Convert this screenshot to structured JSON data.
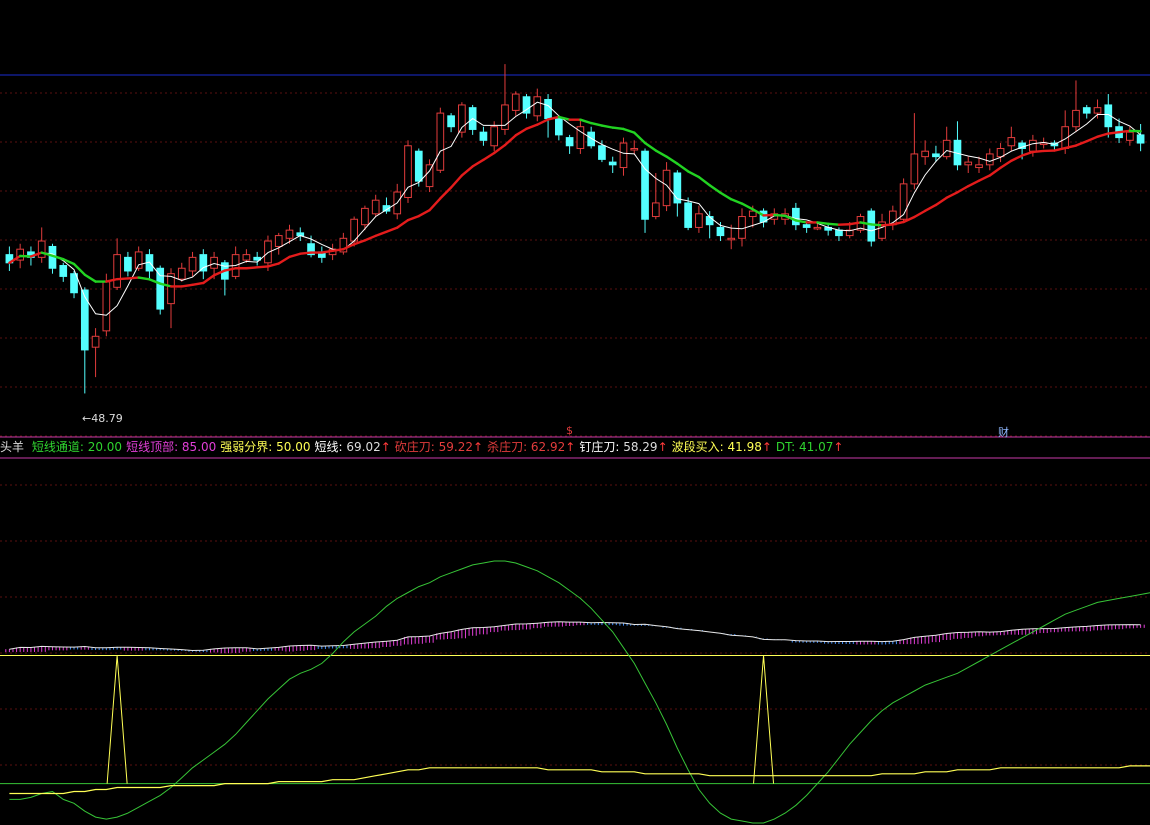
{
  "colors": {
    "background": "#000000",
    "up": "#e23c3c",
    "down": "#54ffff",
    "ma_short": "#ffffff",
    "ma_long_up": "#e41c1c",
    "ma_long_down": "#22d322",
    "grid": "#5a1010",
    "top_rule": "#1a2bd0",
    "separator": "#c83aa8",
    "lower_green": "#37c437",
    "lower_yellow": "#ffff55",
    "hist_up": "#e23fd8",
    "hist_down": "#3f8fff"
  },
  "legend": {
    "name": "头羊",
    "items": [
      {
        "label": "短线通道:",
        "value": "20.00",
        "color": "#2fd32f",
        "arrow": ""
      },
      {
        "label": "短线顶部:",
        "value": "85.00",
        "color": "#e23fd8",
        "arrow": ""
      },
      {
        "label": "强弱分界:",
        "value": "50.00",
        "color": "#ffff55",
        "arrow": ""
      },
      {
        "label": "短线:",
        "value": "69.02",
        "color": "#ffffff",
        "arrow": "↑"
      },
      {
        "label": "砍庄刀:",
        "value": "59.22",
        "color": "#e23c3c",
        "arrow": "↑"
      },
      {
        "label": "杀庄刀:",
        "value": "62.92",
        "color": "#e23c3c",
        "arrow": "↑"
      },
      {
        "label": "钉庄刀:",
        "value": "58.29",
        "color": "#ffffff",
        "arrow": "↑"
      },
      {
        "label": "波段买入:",
        "value": "41.98",
        "color": "#ffff55",
        "arrow": "↑"
      },
      {
        "label": "DT:",
        "value": "41.07",
        "color": "#2fd32f",
        "arrow": "↑"
      }
    ]
  },
  "low_label": "←48.79",
  "markers": {
    "center": "$",
    "right": "财"
  },
  "chart_data": [
    {
      "type": "candlestick",
      "price_range": [
        47.5,
        60.8
      ],
      "candles": [
        [
          54.2,
          53.9,
          54.5,
          53.6
        ],
        [
          54.0,
          54.4,
          54.6,
          53.7
        ],
        [
          54.3,
          54.1,
          54.5,
          53.8
        ],
        [
          54.1,
          54.7,
          55.2,
          53.9
        ],
        [
          54.5,
          53.7,
          54.6,
          53.5
        ],
        [
          53.8,
          53.4,
          53.9,
          53.2
        ],
        [
          53.5,
          52.8,
          53.6,
          52.6
        ],
        [
          52.9,
          50.7,
          53.0,
          49.1
        ],
        [
          50.8,
          51.2,
          51.5,
          49.7
        ],
        [
          51.4,
          53.2,
          53.5,
          51.2
        ],
        [
          53.0,
          54.2,
          54.8,
          52.9
        ],
        [
          54.1,
          53.6,
          54.3,
          53.4
        ],
        [
          53.7,
          54.3,
          54.5,
          53.6
        ],
        [
          54.2,
          53.6,
          54.4,
          53.3
        ],
        [
          53.7,
          52.2,
          53.8,
          52.0
        ],
        [
          52.4,
          53.5,
          53.7,
          51.5
        ],
        [
          53.3,
          53.7,
          53.9,
          53.2
        ],
        [
          53.6,
          54.1,
          54.3,
          53.4
        ],
        [
          54.2,
          53.6,
          54.4,
          53.3
        ],
        [
          53.7,
          54.1,
          54.3,
          53.3
        ],
        [
          53.9,
          53.3,
          54.0,
          52.7
        ],
        [
          53.4,
          54.2,
          54.5,
          53.3
        ],
        [
          54.0,
          54.2,
          54.4,
          53.9
        ],
        [
          54.1,
          54.0,
          54.3,
          53.8
        ],
        [
          53.9,
          54.7,
          54.9,
          53.6
        ],
        [
          54.5,
          54.9,
          55.0,
          54.2
        ],
        [
          54.8,
          55.1,
          55.3,
          54.6
        ],
        [
          55.0,
          54.9,
          55.2,
          54.7
        ],
        [
          54.6,
          54.2,
          54.9,
          54.1
        ],
        [
          54.3,
          54.1,
          54.5,
          53.9
        ],
        [
          54.2,
          54.4,
          54.6,
          54.0
        ],
        [
          54.3,
          54.8,
          55.0,
          54.2
        ],
        [
          54.7,
          55.5,
          55.6,
          54.5
        ],
        [
          55.3,
          55.9,
          56.0,
          55.1
        ],
        [
          55.7,
          56.2,
          56.4,
          55.6
        ],
        [
          56.0,
          55.8,
          56.3,
          55.7
        ],
        [
          55.7,
          56.5,
          56.8,
          55.5
        ],
        [
          56.3,
          58.2,
          58.4,
          56.1
        ],
        [
          58.0,
          56.9,
          58.1,
          56.7
        ],
        [
          56.7,
          57.5,
          57.7,
          56.5
        ],
        [
          57.3,
          59.4,
          59.6,
          57.2
        ],
        [
          59.3,
          58.9,
          59.4,
          58.7
        ],
        [
          58.7,
          59.7,
          59.8,
          58.5
        ],
        [
          59.6,
          58.8,
          59.7,
          58.6
        ],
        [
          58.7,
          58.4,
          58.9,
          58.2
        ],
        [
          58.2,
          58.9,
          59.1,
          58.0
        ],
        [
          58.8,
          59.7,
          61.2,
          58.6
        ],
        [
          59.5,
          60.1,
          60.2,
          59.3
        ],
        [
          60.0,
          59.4,
          60.1,
          59.2
        ],
        [
          59.3,
          60.0,
          60.3,
          59.1
        ],
        [
          59.9,
          59.2,
          60.1,
          58.5
        ],
        [
          59.2,
          58.6,
          59.3,
          58.4
        ],
        [
          58.5,
          58.2,
          58.6,
          57.9
        ],
        [
          58.1,
          58.9,
          59.2,
          57.9
        ],
        [
          58.7,
          58.2,
          58.9,
          58.1
        ],
        [
          58.2,
          57.7,
          58.4,
          57.6
        ],
        [
          57.6,
          57.5,
          57.8,
          57.2
        ],
        [
          57.4,
          58.3,
          58.5,
          57.1
        ],
        [
          58.1,
          58.1,
          58.4,
          57.9
        ],
        [
          58.0,
          55.5,
          58.1,
          55.0
        ],
        [
          55.6,
          56.1,
          57.2,
          55.5
        ],
        [
          56.0,
          57.3,
          57.6,
          55.8
        ],
        [
          57.2,
          56.1,
          57.3,
          55.6
        ],
        [
          56.1,
          55.2,
          56.3,
          55.1
        ],
        [
          55.2,
          55.7,
          56.0,
          55.0
        ],
        [
          55.6,
          55.3,
          55.8,
          54.8
        ],
        [
          55.2,
          54.9,
          55.4,
          54.7
        ],
        [
          54.8,
          54.8,
          55.3,
          54.4
        ],
        [
          54.8,
          55.6,
          55.9,
          54.5
        ],
        [
          55.6,
          55.8,
          56.0,
          55.2
        ],
        [
          55.8,
          55.4,
          55.9,
          55.2
        ],
        [
          55.5,
          55.7,
          55.9,
          55.3
        ],
        [
          55.5,
          55.7,
          55.9,
          55.3
        ],
        [
          55.9,
          55.3,
          56.1,
          55.1
        ],
        [
          55.3,
          55.2,
          55.4,
          55.0
        ],
        [
          55.2,
          55.2,
          55.4,
          55.1
        ],
        [
          55.2,
          55.1,
          55.3,
          54.9
        ],
        [
          55.1,
          54.9,
          55.2,
          54.7
        ],
        [
          54.9,
          55.1,
          55.4,
          54.8
        ],
        [
          55.1,
          55.6,
          55.7,
          55.0
        ],
        [
          55.8,
          54.7,
          55.9,
          54.5
        ],
        [
          54.8,
          55.4,
          55.7,
          54.7
        ],
        [
          55.3,
          55.8,
          56.0,
          55.1
        ],
        [
          55.5,
          56.8,
          57.0,
          55.4
        ],
        [
          56.8,
          57.9,
          59.4,
          56.6
        ],
        [
          57.8,
          58.0,
          58.4,
          57.5
        ],
        [
          57.9,
          57.8,
          58.2,
          57.6
        ],
        [
          57.8,
          58.4,
          58.9,
          57.7
        ],
        [
          58.4,
          57.5,
          59.1,
          57.3
        ],
        [
          57.5,
          57.6,
          57.8,
          57.2
        ],
        [
          57.4,
          57.5,
          57.8,
          57.2
        ],
        [
          57.5,
          57.9,
          58.1,
          57.3
        ],
        [
          57.8,
          58.1,
          58.3,
          57.6
        ],
        [
          58.2,
          58.5,
          58.9,
          58.0
        ],
        [
          58.3,
          58.1,
          58.4,
          57.7
        ],
        [
          58.0,
          58.4,
          58.6,
          57.8
        ],
        [
          58.3,
          58.3,
          58.5,
          58.1
        ],
        [
          58.3,
          58.2,
          58.4,
          58.0
        ],
        [
          58.1,
          58.9,
          59.5,
          57.9
        ],
        [
          58.9,
          59.5,
          60.6,
          58.7
        ],
        [
          59.6,
          59.4,
          59.7,
          59.2
        ],
        [
          59.4,
          59.6,
          59.9,
          59.2
        ],
        [
          59.7,
          58.9,
          60.1,
          58.5
        ],
        [
          58.9,
          58.5,
          59.2,
          58.3
        ],
        [
          58.4,
          58.7,
          58.9,
          58.2
        ],
        [
          58.6,
          58.3,
          59.0,
          58.0
        ]
      ]
    },
    {
      "type": "line",
      "x_count": 107,
      "y_range": [
        0,
        100
      ],
      "series": [
        {
          "name": "短线通道",
          "constant": 20.0
        },
        {
          "name": "短线顶部",
          "constant": 85.0
        },
        {
          "name": "强弱分界",
          "constant": 50.0
        },
        {
          "name": "波段买入",
          "values": [
            12,
            12,
            13,
            15,
            16,
            12,
            10,
            6,
            3,
            2,
            3,
            5,
            8,
            11,
            14,
            18,
            23,
            28,
            32,
            36,
            40,
            45,
            51,
            57,
            63,
            68,
            73,
            76,
            78,
            81,
            86,
            92,
            97,
            101,
            105,
            110,
            114,
            117,
            120,
            122,
            125,
            127,
            129,
            131,
            132,
            133,
            133,
            132,
            130,
            128,
            125,
            122,
            118,
            114,
            109,
            103,
            97,
            89,
            81,
            71,
            61,
            50,
            38,
            27,
            17,
            10,
            5,
            2,
            1,
            0,
            0,
            2,
            5,
            9,
            14,
            20,
            26,
            33,
            40,
            46,
            52,
            57,
            61,
            64,
            67,
            70,
            72,
            74,
            76,
            79,
            82,
            85,
            88,
            91,
            94,
            97,
            100,
            103,
            106,
            108,
            110,
            112,
            113,
            114,
            115,
            116,
            117
          ]
        },
        {
          "name": "DT",
          "values": [
            15,
            15,
            15,
            15,
            15,
            15,
            16,
            16,
            17,
            17,
            18,
            18,
            18,
            18,
            18,
            19,
            19,
            19,
            19,
            19,
            20,
            20,
            20,
            20,
            20,
            21,
            21,
            21,
            21,
            21,
            22,
            22,
            22,
            23,
            24,
            25,
            26,
            27,
            27,
            28,
            28,
            28,
            28,
            28,
            28,
            28,
            28,
            28,
            28,
            28,
            27,
            27,
            27,
            27,
            27,
            26,
            26,
            26,
            26,
            25,
            25,
            25,
            25,
            25,
            25,
            24,
            24,
            24,
            24,
            24,
            24,
            24,
            24,
            24,
            24,
            24,
            24,
            24,
            24,
            24,
            24,
            25,
            25,
            25,
            25,
            26,
            26,
            26,
            27,
            27,
            27,
            27,
            28,
            28,
            28,
            28,
            28,
            28,
            28,
            28,
            28,
            28,
            28,
            28,
            29,
            29,
            29
          ]
        }
      ]
    }
  ]
}
